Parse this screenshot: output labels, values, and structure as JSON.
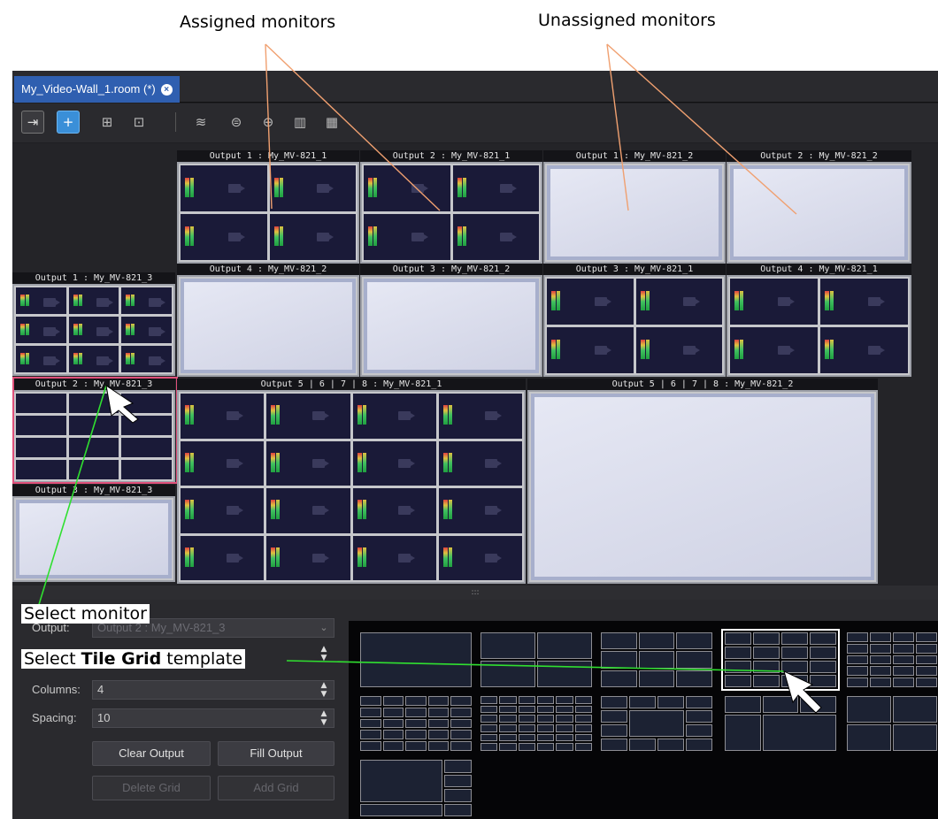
{
  "annotations": {
    "assigned": "Assigned monitors",
    "unassigned": "Unassigned monitors",
    "select_monitor": "Select monitor",
    "select_tile_prefix": "Select ",
    "select_tile_bold": "Tile Grid",
    "select_tile_suffix": " template"
  },
  "tab": {
    "label": "My_Video-Wall_1.room (*)",
    "close_icon": "close-icon"
  },
  "toolbar": {
    "icons": [
      "exit-icon",
      "add-monitor-icon",
      "link-icon",
      "grid-icon",
      "layers-icon",
      "layer-remove-icon",
      "add-layer-icon",
      "delete-icon",
      "tiles-icon"
    ]
  },
  "monitors": {
    "o1_mv1": "Output 1 : My_MV-821_1",
    "o2_mv1": "Output 2 : My_MV-821_1",
    "o1_mv2": "Output 1 : My_MV-821_2",
    "o2_mv2": "Output 2 : My_MV-821_2",
    "o4_mv2": "Output 4 : My_MV-821_2",
    "o3_mv2": "Output 3 : My_MV-821_2",
    "o3_mv1": "Output 3 : My_MV-821_1",
    "o4_mv1": "Output 4 : My_MV-821_1",
    "o1_mv3": "Output 1 : My_MV-821_3",
    "o2_mv3": "Output 2 : My_MV-821_3",
    "o3_mv3": "Output 3 : My_MV-821_3",
    "o5_mv1": "Output 5 | 6 | 7 | 8 : My_MV-821_1",
    "o5_mv2": "Output 5 | 6 | 7 | 8 : My_MV-821_2"
  },
  "divider": {
    "grip": ":::"
  },
  "panel": {
    "output_label": "Output:",
    "output_value": "Output 2 : My_MV-821_3",
    "columns_label": "Columns:",
    "columns_value": "4",
    "spacing_label": "Spacing:",
    "spacing_value": "10",
    "clear_output": "Clear Output",
    "fill_output": "Fill Output",
    "delete_grid": "Delete Grid",
    "add_grid": "Add Grid"
  },
  "colors": {
    "tab_active": "#2f5fb0",
    "toolbar_active": "#3a8fd8",
    "selected_monitor_border": "#e0507a",
    "callout_orange": "#f0a070",
    "callout_green": "#30e030"
  }
}
